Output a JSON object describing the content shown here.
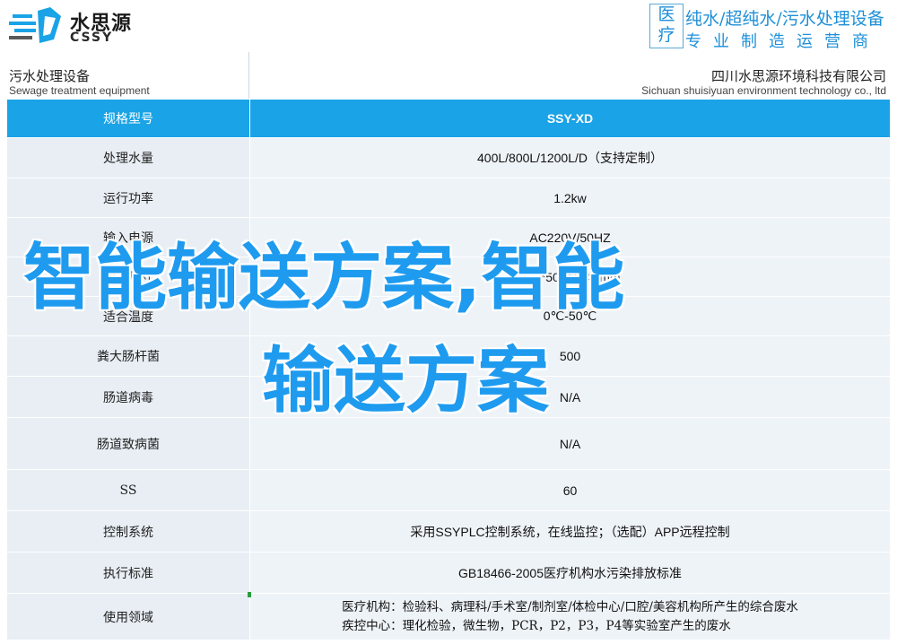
{
  "header": {
    "logo_cn": "水思源",
    "logo_en": "CSSY",
    "tag_box": [
      "医",
      "疗"
    ],
    "tag_line1": "纯水/超纯水/污水处理设备",
    "tag_line2": "专业制造运营商"
  },
  "subheader": {
    "left_cn": "污水处理设备",
    "left_en": "Sewage treatment equipment",
    "right_cn": "四川水思源环境科技有限公司",
    "right_en": "Sichuan shuisiyuan environment technology co., ltd"
  },
  "table": {
    "header": {
      "label": "规格型号",
      "value": "SSY-XD"
    },
    "rows": [
      {
        "label": "处理水量",
        "value": "400L/800L/1200L/D（支持定制）"
      },
      {
        "label": "运行功率",
        "value": "1.2kw"
      },
      {
        "label": "输入电源",
        "value": "AC220V/50HZ"
      },
      {
        "label": "智能尺寸",
        "value": "600*500*1440mm"
      },
      {
        "label": "适合温度",
        "value": "0℃-50℃"
      },
      {
        "label": "粪大肠杆菌",
        "value": "500"
      },
      {
        "label": "肠道病毒",
        "value": "N/A"
      },
      {
        "label": "肠道致病菌",
        "value": "N/A"
      },
      {
        "label": "SS",
        "value": "60"
      },
      {
        "label": "控制系统",
        "value": "采用SSYPLC控制系统，在线监控；（选配）APP远程控制"
      },
      {
        "label": "执行标准",
        "value": "GB18466-2005医疗机构水污染排放标准"
      },
      {
        "label": "使用领域",
        "value_lines": [
          "医疗机构：检验科、病理科/手术室/制剂室/体检中心/口腔/美容机构所产生的综合废水",
          "疾控中心：理化检验，微生物，PCR，P2，P3，P4等实验室产生的废水"
        ]
      }
    ]
  },
  "overlay": {
    "line1": "智能输送方案,智能",
    "line2": "输送方案"
  },
  "colors": {
    "accent": "#1aa3e6",
    "overlay_text": "#1e9bef",
    "row_bg": "#e8eef4",
    "tagline": "#1e8fd8"
  }
}
